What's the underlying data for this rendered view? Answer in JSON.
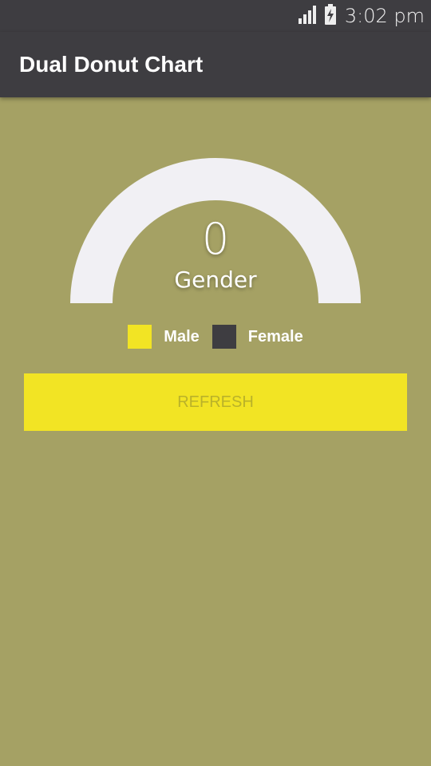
{
  "status_bar": {
    "time": "3:02 pm",
    "icons": [
      "signal-icon",
      "battery-charging-icon"
    ]
  },
  "app_bar": {
    "title": "Dual Donut Chart"
  },
  "gauge": {
    "value": "0",
    "label": "Gender",
    "arc_color": "#f1f0f4"
  },
  "legend": [
    {
      "label": "Male",
      "color": "#f2e424"
    },
    {
      "label": "Female",
      "color": "#3e3d41"
    }
  ],
  "refresh_button": {
    "label": "REFRESH"
  },
  "colors": {
    "background": "#a5a164",
    "app_bar": "#3e3d41",
    "accent": "#f2e424",
    "button_text": "#bab229"
  }
}
